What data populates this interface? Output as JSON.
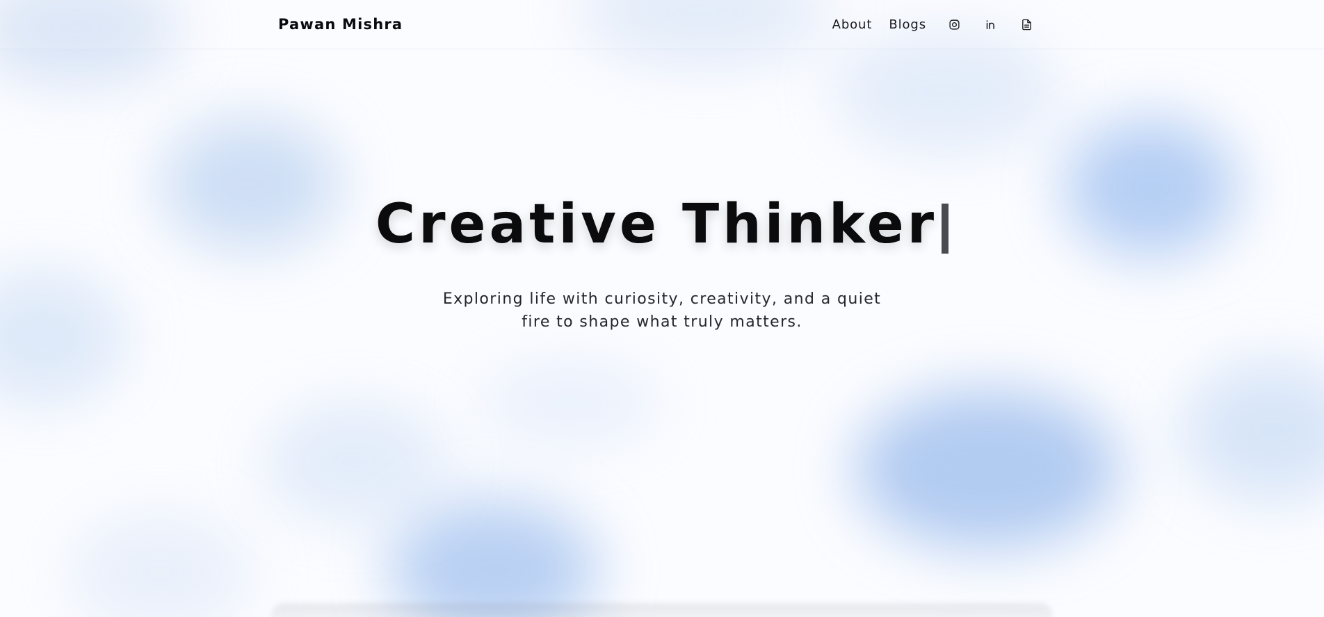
{
  "header": {
    "brand": "Pawan Mishra",
    "nav": {
      "about": "About",
      "blogs": "Blogs"
    },
    "social_icons": [
      "instagram-icon",
      "linkedin-icon",
      "document-icon"
    ]
  },
  "hero": {
    "headline": "Creative Thinker",
    "subtitle": "Exploring life with curiosity, creativity, and a quiet fire to shape what truly matters."
  },
  "colors": {
    "text": "#0b0b0d",
    "background": "#fbfcff",
    "accent_blobs": "#7ea8e6"
  }
}
